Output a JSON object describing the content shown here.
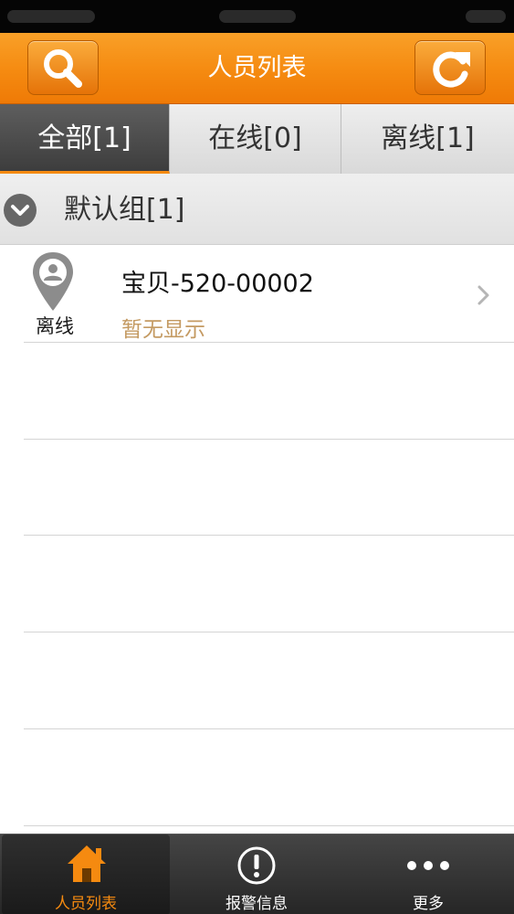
{
  "header": {
    "title": "人员列表",
    "search_icon": "search-icon",
    "refresh_icon": "refresh-icon"
  },
  "tabs": [
    {
      "label": "全部[1]",
      "active": true
    },
    {
      "label": "在线[0]",
      "active": false
    },
    {
      "label": "离线[1]",
      "active": false
    }
  ],
  "group": {
    "label": "默认组[1]",
    "icon": "chevron-down-icon"
  },
  "items": [
    {
      "name": "宝贝-520-00002",
      "status": "离线",
      "subtitle": "暂无显示",
      "icon": "person-pin-icon"
    }
  ],
  "bottom_nav": [
    {
      "label": "人员列表",
      "icon": "home-icon",
      "active": true
    },
    {
      "label": "报警信息",
      "icon": "alert-icon",
      "active": false
    },
    {
      "label": "更多",
      "icon": "more-icon",
      "active": false
    }
  ],
  "colors": {
    "accent": "#f58a10",
    "subtitle": "#c49a62",
    "tab_active_bg": "#4a4a4a",
    "bottom_bar_bg": "#2e2e2e"
  }
}
